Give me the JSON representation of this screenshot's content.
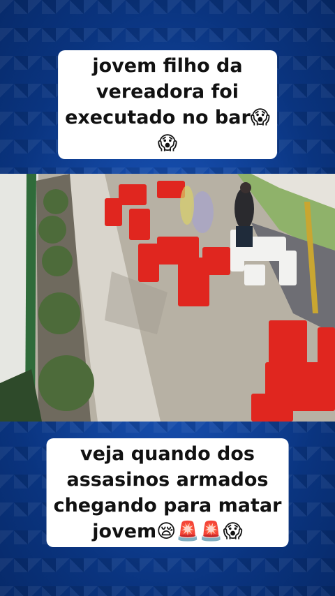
{
  "top_caption": {
    "lines": [
      "jovem filho da",
      "vereadora foi",
      "executado no bar😱",
      "😱"
    ]
  },
  "bottom_caption": {
    "lines": [
      "veja quando dos",
      "assasinos armados",
      "chegando para matar",
      "jovem😪🚨🚨😱"
    ]
  },
  "colors": {
    "background": "#0b3a8f",
    "caption_bg": "#ffffff",
    "caption_text": "#111111",
    "chairs": "#e0261f"
  },
  "video": {
    "description_icon": "cctv-video-frame"
  }
}
